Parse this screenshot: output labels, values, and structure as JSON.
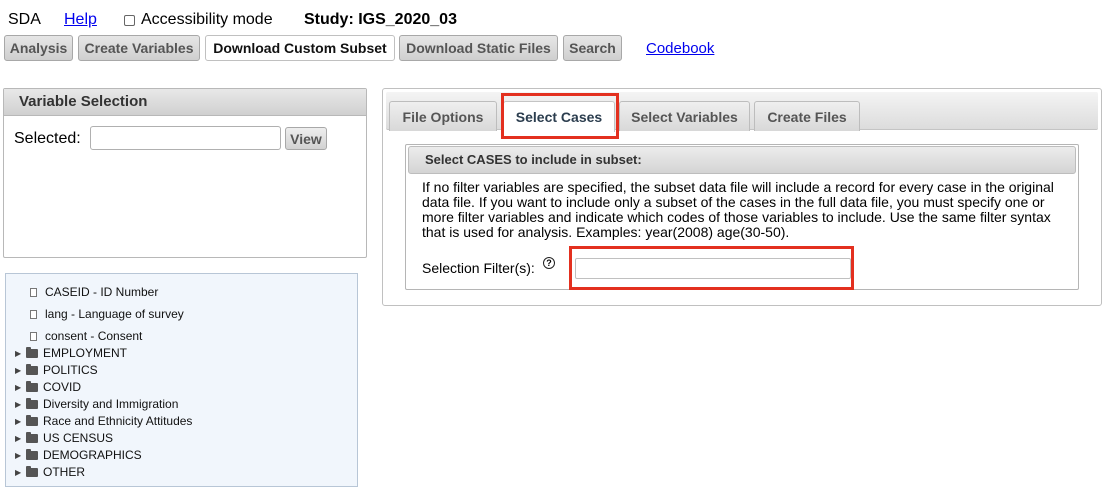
{
  "topbar": {
    "app_name": "SDA",
    "help_link": "Help",
    "accessibility_label": "Accessibility mode",
    "accessibility_checked": false,
    "study": "Study: IGS_2020_03"
  },
  "toolbar": {
    "analysis": "Analysis",
    "create_variables": "Create Variables",
    "download_custom_subset": "Download Custom Subset",
    "download_static_files": "Download Static Files",
    "search": "Search",
    "codebook": "Codebook"
  },
  "variable_selection": {
    "header": "Variable Selection",
    "selected_label": "Selected:",
    "selected_value": "",
    "view_button": "View"
  },
  "tree": {
    "variables": [
      {
        "label": "CASEID - ID Number"
      },
      {
        "label": "lang - Language of survey"
      },
      {
        "label": "consent - Consent"
      }
    ],
    "folders": [
      {
        "label": "EMPLOYMENT"
      },
      {
        "label": "POLITICS"
      },
      {
        "label": "COVID"
      },
      {
        "label": "Diversity and Immigration"
      },
      {
        "label": "Race and Ethnicity Attitudes"
      },
      {
        "label": "US CENSUS"
      },
      {
        "label": "DEMOGRAPHICS"
      },
      {
        "label": "OTHER"
      }
    ]
  },
  "tabs": [
    {
      "label": "File Options",
      "active": false
    },
    {
      "label": "Select Cases",
      "active": true
    },
    {
      "label": "Select Variables",
      "active": false
    },
    {
      "label": "Create Files",
      "active": false
    }
  ],
  "select_cases": {
    "header": "Select CASES to include in subset:",
    "description": "If no filter variables are specified, the subset data file will include a record for every case in the original data file. If you want to include only a subset of the cases in the full data file, you must specify one or more filter variables and indicate which codes of those variables to include. Use the same filter syntax that is used for analysis. Examples: year(2008) age(30-50).",
    "filter_label": "Selection Filter(s):",
    "filter_help_icon": "question-circle-icon",
    "filter_value": ""
  },
  "colors": {
    "highlight": "#e3301f",
    "link": "#0000ee",
    "tree_background": "#f1f6fc"
  }
}
